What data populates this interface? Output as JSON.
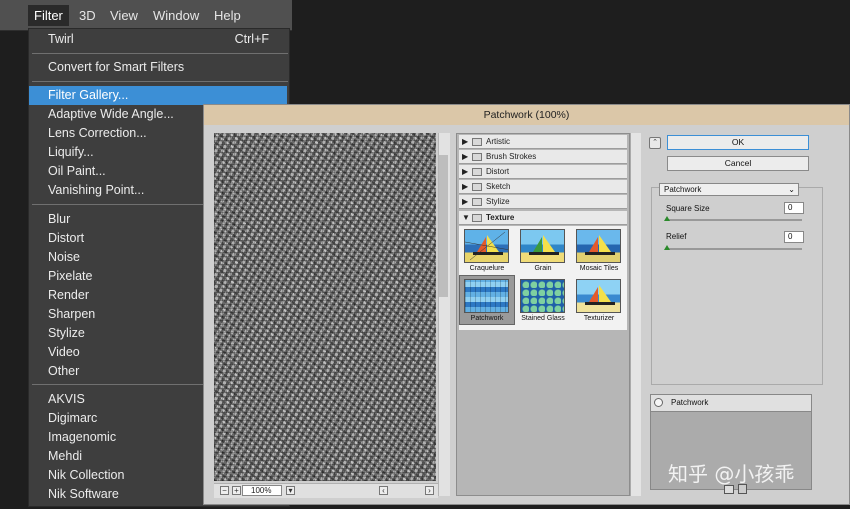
{
  "menubar": {
    "items": [
      "Filter",
      "3D",
      "View",
      "Window",
      "Help"
    ]
  },
  "filter_menu": {
    "last_filter": {
      "label": "Twirl",
      "shortcut": "Ctrl+F"
    },
    "convert": "Convert for Smart Filters",
    "group1": [
      "Filter Gallery...",
      "Adaptive Wide Angle...",
      "Lens Correction...",
      "Liquify...",
      "Oil Paint...",
      "Vanishing Point..."
    ],
    "group2": [
      "Blur",
      "Distort",
      "Noise",
      "Pixelate",
      "Render",
      "Sharpen",
      "Stylize",
      "Video",
      "Other"
    ],
    "group3": [
      "AKVIS",
      "Digimarc",
      "Imagenomic",
      "Mehdi",
      "Nik Collection",
      "Nik Software"
    ],
    "highlighted": "Filter Gallery..."
  },
  "dialog": {
    "title": "Patchwork (100%)",
    "zoom": "100%",
    "categories": [
      "Artistic",
      "Brush Strokes",
      "Distort",
      "Sketch",
      "Stylize"
    ],
    "open_category": "Texture",
    "thumbnails": [
      "Craquelure",
      "Grain",
      "Mosaic Tiles",
      "Patchwork",
      "Stained Glass",
      "Texturizer"
    ],
    "selected_thumbnail": "Patchwork",
    "ok_label": "OK",
    "cancel_label": "Cancel",
    "filter_select": "Patchwork",
    "params": [
      {
        "label": "Square Size",
        "value": "0"
      },
      {
        "label": "Relief",
        "value": "0"
      }
    ],
    "layer_name": "Patchwork"
  },
  "watermark": "知乎 @小孩乖",
  "colors": {
    "highlight": "#3c8fd6",
    "title_bar": "#dbc7a8",
    "menu_bg": "#3e3e3e"
  }
}
